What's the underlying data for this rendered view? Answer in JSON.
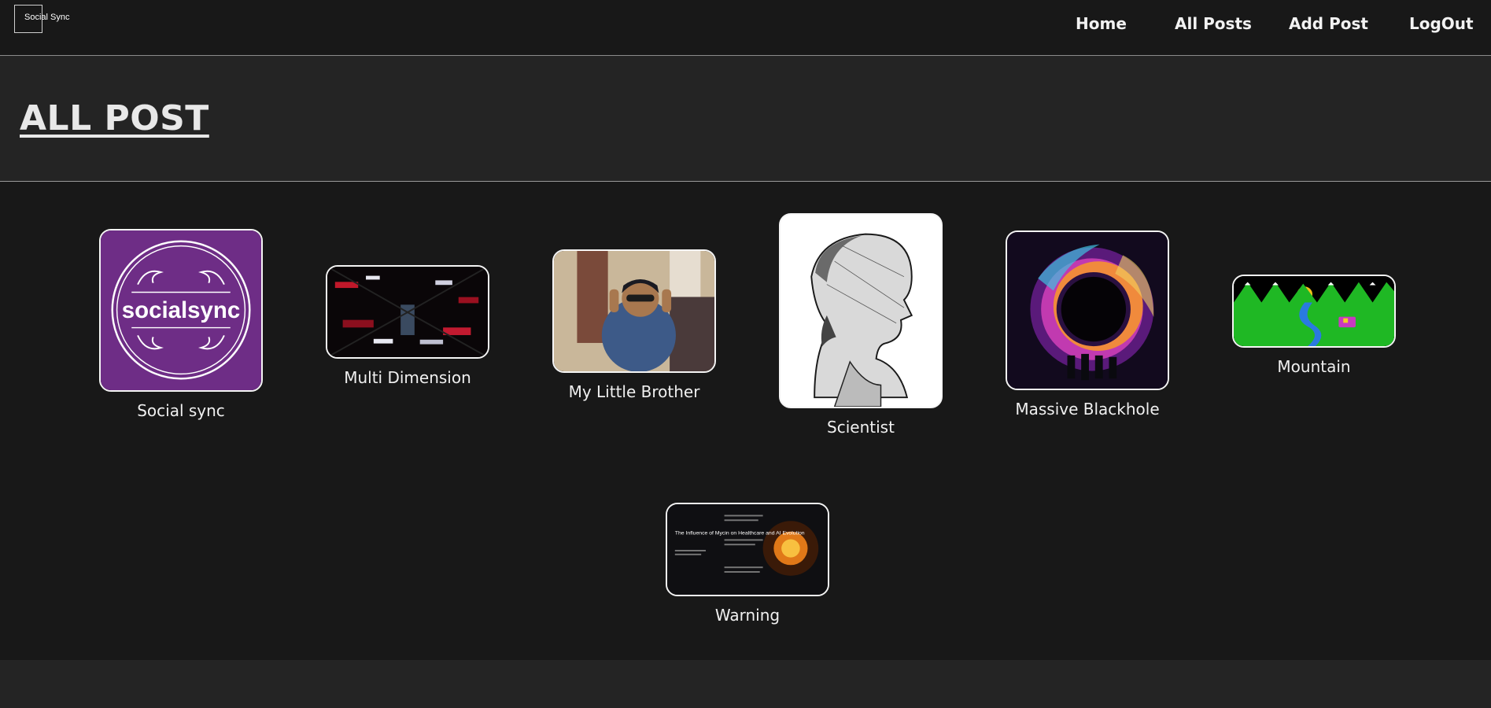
{
  "brand": {
    "name": "Social Sync"
  },
  "nav": {
    "home": "Home",
    "all_posts": "All Posts",
    "add_post": "Add Post",
    "logout": "LogOut"
  },
  "page": {
    "title": "ALL POST"
  },
  "posts": [
    {
      "caption": "Social sync",
      "image": "socialsync-logo",
      "logo_text": "socialsync"
    },
    {
      "caption": "Multi Dimension",
      "image": "multi-dimension-tunnel"
    },
    {
      "caption": "My Little Brother",
      "image": "boy-with-sunglasses"
    },
    {
      "caption": "Scientist",
      "image": "scientist-engraving"
    },
    {
      "caption": "Massive Blackhole",
      "image": "blackhole-art"
    },
    {
      "caption": "Mountain",
      "image": "mountain-landscape"
    },
    {
      "caption": "Warning",
      "image": "slide-the-influence-of-mycin",
      "slide_title": "The Influence of Mycin on Healthcare and AI Evolution"
    }
  ],
  "colors": {
    "nav_bg": "#181818",
    "band_bg": "#242424",
    "content_bg": "#181818",
    "text": "#ffffff"
  }
}
